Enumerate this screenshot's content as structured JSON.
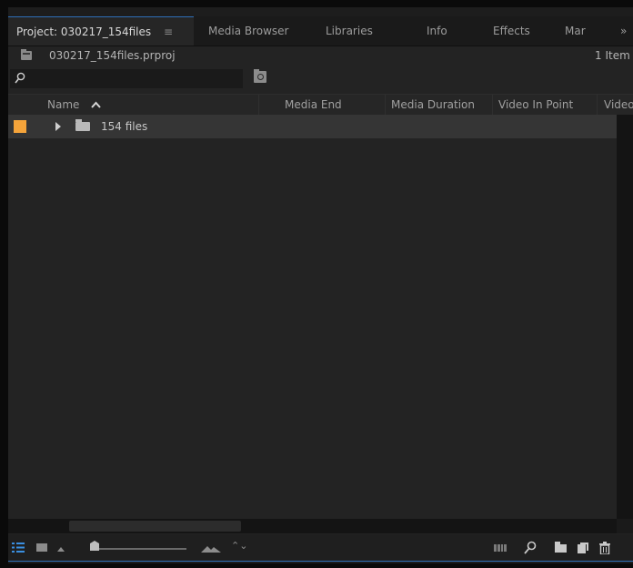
{
  "tabs": [
    {
      "label": "Project: 030217_154files",
      "active": true
    },
    {
      "label": "Media Browser"
    },
    {
      "label": "Libraries"
    },
    {
      "label": "Info"
    },
    {
      "label": "Effects"
    },
    {
      "label": "Mar"
    }
  ],
  "tab_menu_glyph": "≡",
  "tab_overflow_glyph": "»",
  "project": {
    "file_name": "030217_154files.prproj",
    "item_count": "1 Item"
  },
  "columns": [
    {
      "label": "Name",
      "sorted": "ascending"
    },
    {
      "label": "Media End"
    },
    {
      "label": "Media Duration"
    },
    {
      "label": "Video In Point"
    },
    {
      "label": "Video"
    }
  ],
  "sort_arrow_glyph": "^",
  "rows": [
    {
      "name": "154 files",
      "type": "bin",
      "label_color": "#f5a43a",
      "expanded": false
    }
  ],
  "toolbar": {
    "sort_icons_glyph": "⌃⌄",
    "icons": [
      "list-view-icon",
      "icon-view-icon",
      "zoom-out-icon",
      "zoom-in-icon",
      "sort-icon",
      "freeform-view-icon",
      "find-icon",
      "new-bin-icon",
      "new-item-icon",
      "clear-icon"
    ]
  },
  "colors": {
    "accent": "#2f6fb8",
    "label_mango": "#f5a43a",
    "panel_bg": "#232323"
  }
}
